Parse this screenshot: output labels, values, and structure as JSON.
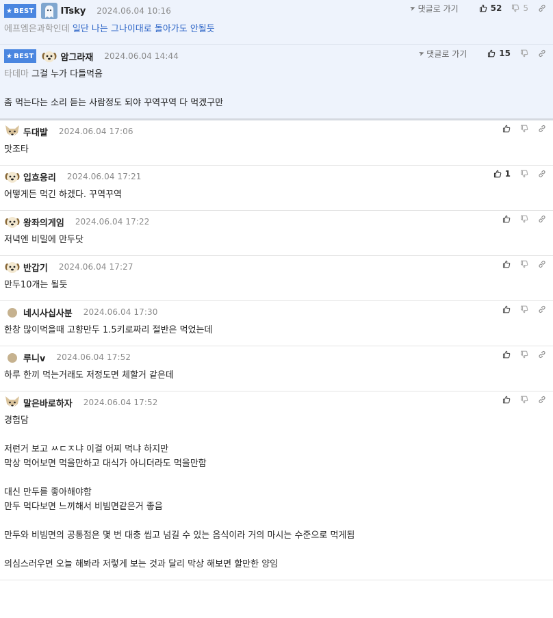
{
  "labels": {
    "best": "BEST",
    "goto": "댓글로 가기"
  },
  "comments": [
    {
      "best": true,
      "author": "ITsky",
      "avatar": "ghost-avatar",
      "date": "2024.06.04 10:16",
      "up": "52",
      "down": "5",
      "prefix": "에프엠은과학인데",
      "prefix_style": "grey",
      "text": " 일단 나는 그나이대로 돌아가도 안될듯",
      "text_style": "blue"
    },
    {
      "best": true,
      "author": "암그라재",
      "avatar": "dog-avatar",
      "date": "2024.06.04 14:44",
      "up": "15",
      "down": "",
      "prefix": "타데마",
      "prefix_style": "grey",
      "text": " 그걸 누가 다들먹음\n\n좀 먹는다는 소리 듣는 사람정도 되야 꾸역꾸역 다 먹겠구만",
      "text_style": "black"
    },
    {
      "best": false,
      "author": "두대발",
      "avatar": "fox-avatar",
      "date": "2024.06.04 17:06",
      "up": "",
      "prefix": "",
      "text": "맛조타"
    },
    {
      "best": false,
      "author": "입흐응리",
      "avatar": "dog-avatar",
      "date": "2024.06.04 17:21",
      "up": "1",
      "prefix": "",
      "text": "어떻게든 먹긴 하겠다. 꾸역꾸역"
    },
    {
      "best": false,
      "author": "왕좌의게임",
      "avatar": "dog-avatar",
      "date": "2024.06.04 17:22",
      "up": "",
      "prefix": "",
      "text": "저녁엔 비밀에 만두닷"
    },
    {
      "best": false,
      "author": "반갑기",
      "avatar": "dog-avatar",
      "date": "2024.06.04 17:27",
      "up": "",
      "prefix": "",
      "text": "만두10개는 될듯"
    },
    {
      "best": false,
      "author": "네시사십사분",
      "avatar": "dot-avatar",
      "date": "2024.06.04 17:30",
      "up": "",
      "prefix": "",
      "text": "한창 많이먹을때 고향만두 1.5키로짜리 절반은 먹었는데"
    },
    {
      "best": false,
      "author": "루니v",
      "avatar": "dot-avatar",
      "date": "2024.06.04 17:52",
      "up": "",
      "prefix": "",
      "text": "하루 한끼 먹는거래도 저정도면 체할거 같은데"
    },
    {
      "best": false,
      "author": "말은바로하자",
      "avatar": "fox-avatar",
      "date": "2024.06.04 17:52",
      "up": "",
      "prefix": "",
      "text": "경험담\n\n저런거 보고 ㅆㄷㅈ냐 이걸 어찌 먹냐 하지만\n막상 먹어보면 먹을만하고 대식가 아니더라도 먹을만함\n\n대신 만두를 좋아해야함\n만두 먹다보면 느끼해서 비빔면같은거 좋음\n\n만두와 비빔면의 공통점은 몇 번 대충 씹고 넘길 수 있는 음식이라 거의 마시는 수준으로 먹게됨\n\n의심스러우면 오늘 해봐라 저렇게 보는 것과 달리 막상 해보면 할만한 양임"
    }
  ]
}
